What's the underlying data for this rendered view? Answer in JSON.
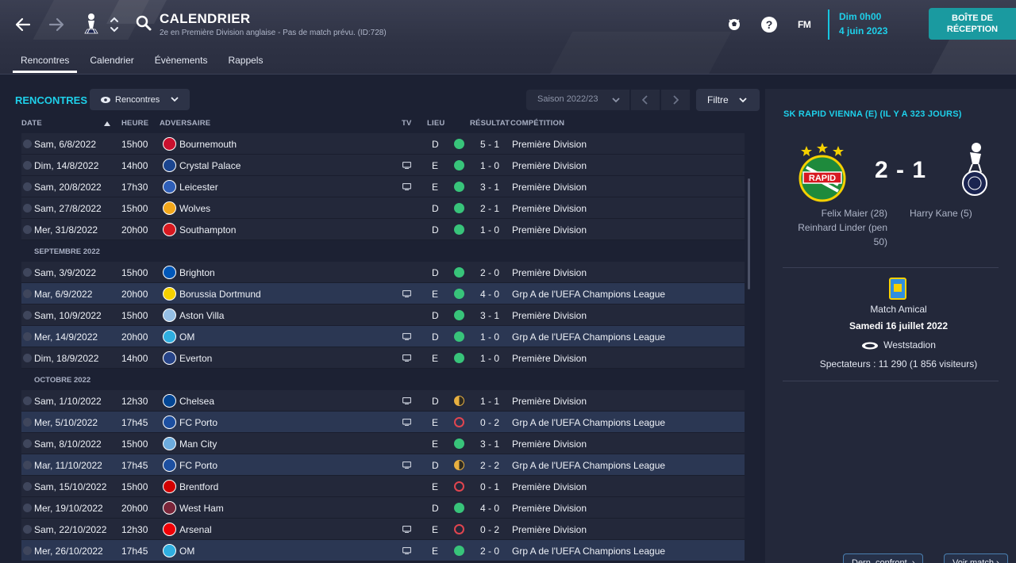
{
  "header": {
    "title": "CALENDRIER",
    "subtitle": "2e en Première Division anglaise - Pas de match prévu. (ID:728)",
    "tabs": [
      "Rencontres",
      "Calendrier",
      "Évènements",
      "Rappels"
    ],
    "date_line1": "Dim 0h00",
    "date_line2": "4 juin 2023",
    "fm_label": "FM",
    "inbox_line1": "BOÎTE DE",
    "inbox_line2": "RÉCEPTION",
    "icons": [
      "back-arrow-icon",
      "forward-arrow-icon",
      "club-crest-icon",
      "up-down-icon",
      "search-icon",
      "football-icon",
      "help-icon"
    ]
  },
  "toolbar": {
    "section_title": "RENCONTRES",
    "view_dropdown": "Rencontres",
    "season": "Saison 2022/23",
    "filter": "Filtre"
  },
  "columns": {
    "date": "DATE",
    "time": "HEURE",
    "opponent": "ADVERSAIRE",
    "tv": "TV",
    "venue": "LIEU",
    "result": "RÉSULTAT",
    "competition": "COMPÉTITION"
  },
  "colors": {
    "accent": "#1ed0ea",
    "win": "#38c47a",
    "loss": "#e0454f",
    "draw": "#e8b040",
    "inbox": "#1a9aa0"
  },
  "rows": [
    {
      "date": "Sam, 6/8/2022",
      "time": "15h00",
      "opponent": "Bournemouth",
      "tv": false,
      "venue": "D",
      "outcome": "win",
      "score": "5 - 1",
      "competition": "Première Division",
      "crest": "#c8102e"
    },
    {
      "date": "Dim, 14/8/2022",
      "time": "14h00",
      "opponent": "Crystal Palace",
      "tv": true,
      "venue": "E",
      "outcome": "win",
      "score": "1 - 0",
      "competition": "Première Division",
      "crest": "#1b458f"
    },
    {
      "date": "Sam, 20/8/2022",
      "time": "17h30",
      "opponent": "Leicester",
      "tv": true,
      "venue": "E",
      "outcome": "win",
      "score": "3 - 1",
      "competition": "Première Division",
      "crest": "#2f5fb8"
    },
    {
      "date": "Sam, 27/8/2022",
      "time": "15h00",
      "opponent": "Wolves",
      "tv": false,
      "venue": "D",
      "outcome": "win",
      "score": "2 - 1",
      "competition": "Première Division",
      "crest": "#f2a71b"
    },
    {
      "date": "Mer, 31/8/2022",
      "time": "20h00",
      "opponent": "Southampton",
      "tv": false,
      "venue": "D",
      "outcome": "win",
      "score": "1 - 0",
      "competition": "Première Division",
      "crest": "#d71920"
    },
    {
      "month": "SEPTEMBRE 2022"
    },
    {
      "date": "Sam, 3/9/2022",
      "time": "15h00",
      "opponent": "Brighton",
      "tv": false,
      "venue": "D",
      "outcome": "win",
      "score": "2 - 0",
      "competition": "Première Division",
      "crest": "#0057b8"
    },
    {
      "date": "Mar, 6/9/2022",
      "time": "20h00",
      "opponent": "Borussia Dortmund",
      "tv": true,
      "venue": "E",
      "outcome": "win",
      "score": "4 - 0",
      "competition": "Grp A de l'UEFA Champions League",
      "crest": "#f5d000",
      "hl": true
    },
    {
      "date": "Sam, 10/9/2022",
      "time": "15h00",
      "opponent": "Aston Villa",
      "tv": false,
      "venue": "D",
      "outcome": "win",
      "score": "3 - 1",
      "competition": "Première Division",
      "crest": "#95bfe5"
    },
    {
      "date": "Mer, 14/9/2022",
      "time": "20h00",
      "opponent": "OM",
      "tv": true,
      "venue": "D",
      "outcome": "win",
      "score": "1 - 0",
      "competition": "Grp A de l'UEFA Champions League",
      "crest": "#2faee0",
      "hl": true
    },
    {
      "date": "Dim, 18/9/2022",
      "time": "14h00",
      "opponent": "Everton",
      "tv": true,
      "venue": "E",
      "outcome": "win",
      "score": "1 - 0",
      "competition": "Première Division",
      "crest": "#274488"
    },
    {
      "month": "OCTOBRE 2022"
    },
    {
      "date": "Sam, 1/10/2022",
      "time": "12h30",
      "opponent": "Chelsea",
      "tv": true,
      "venue": "D",
      "outcome": "draw",
      "score": "1 - 1",
      "competition": "Première Division",
      "crest": "#034694"
    },
    {
      "date": "Mer, 5/10/2022",
      "time": "17h45",
      "opponent": "FC Porto",
      "tv": true,
      "venue": "E",
      "outcome": "loss",
      "score": "0 - 2",
      "competition": "Grp A de l'UEFA Champions League",
      "crest": "#1d4fa0",
      "hl": true
    },
    {
      "date": "Sam, 8/10/2022",
      "time": "15h00",
      "opponent": "Man City",
      "tv": false,
      "venue": "E",
      "outcome": "win",
      "score": "3 - 1",
      "competition": "Première Division",
      "crest": "#6cabdd"
    },
    {
      "date": "Mar, 11/10/2022",
      "time": "17h45",
      "opponent": "FC Porto",
      "tv": true,
      "venue": "D",
      "outcome": "draw",
      "score": "2 - 2",
      "competition": "Grp A de l'UEFA Champions League",
      "crest": "#1d4fa0",
      "hl": true
    },
    {
      "date": "Sam, 15/10/2022",
      "time": "15h00",
      "opponent": "Brentford",
      "tv": false,
      "venue": "E",
      "outcome": "loss",
      "score": "0 - 1",
      "competition": "Première Division",
      "crest": "#d20000"
    },
    {
      "date": "Mer, 19/10/2022",
      "time": "20h00",
      "opponent": "West Ham",
      "tv": false,
      "venue": "D",
      "outcome": "win",
      "score": "4 - 0",
      "competition": "Première Division",
      "crest": "#7a263a"
    },
    {
      "date": "Sam, 22/10/2022",
      "time": "12h30",
      "opponent": "Arsenal",
      "tv": true,
      "venue": "E",
      "outcome": "loss",
      "score": "0 - 2",
      "competition": "Première Division",
      "crest": "#ef0107"
    },
    {
      "date": "Mer, 26/10/2022",
      "time": "17h45",
      "opponent": "OM",
      "tv": true,
      "venue": "E",
      "outcome": "win",
      "score": "2 - 0",
      "competition": "Grp A de l'UEFA Champions League",
      "crest": "#2faee0",
      "hl": true
    }
  ],
  "detail": {
    "title": "SK RAPID VIENNA (E) (IL Y A 323 JOURS)",
    "score": "2 - 1",
    "home_crest_text": "RAPID",
    "home_scorers_line1": "Felix Maier (28)",
    "home_scorers_line2": "Reinhard Linder (pen",
    "home_scorers_line3": "50)",
    "away_scorers": "Harry Kane (5)",
    "competition": "Match Amical",
    "date": "Samedi 16 juillet 2022",
    "stadium": "Weststadion",
    "attendance": "Spectateurs : 11 290 (1 856 visiteurs)",
    "btn_h2h": "Dern. confront. ›",
    "btn_view": "Voir match ›"
  }
}
